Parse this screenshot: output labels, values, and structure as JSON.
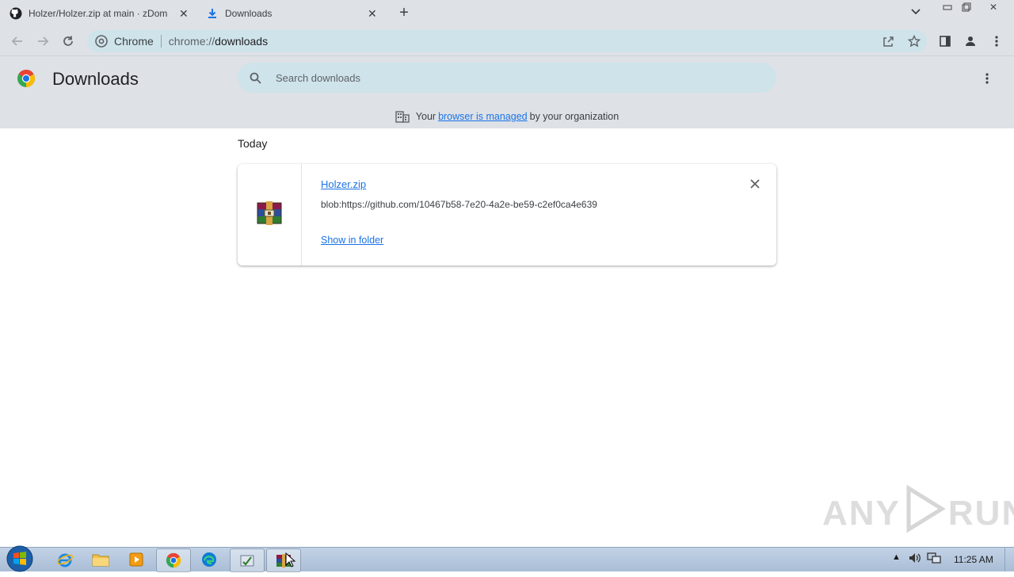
{
  "window": {
    "tabs": [
      {
        "title": "Holzer/Holzer.zip at main · zDom",
        "favicon": "github-icon"
      },
      {
        "title": "Downloads",
        "favicon": "download-icon"
      }
    ],
    "new_tab_symbol": "+"
  },
  "toolbar": {
    "site_chip": "Chrome",
    "url_scheme": "chrome://",
    "url_host": "downloads"
  },
  "header": {
    "title": "Downloads",
    "search_placeholder": "Search downloads"
  },
  "managed_notice": {
    "prefix": "Your",
    "link": "browser is managed",
    "suffix": "by your organization"
  },
  "downloads": {
    "date_heading": "Today",
    "items": [
      {
        "file_name": "Holzer.zip",
        "url": "blob:https://github.com/10467b58-7e20-4a2e-be59-c2ef0ca4e639",
        "action": "Show in folder",
        "icon": "winrar-archive-icon"
      }
    ]
  },
  "watermark": {
    "left": "ANY",
    "right": "RUN"
  },
  "taskbar": {
    "pinned": [
      "internet-explorer-icon",
      "file-explorer-icon",
      "media-player-icon",
      "chrome-icon",
      "edge-icon",
      "installer-icon",
      "winrar-icon"
    ],
    "clock": "11:25 AM"
  }
}
